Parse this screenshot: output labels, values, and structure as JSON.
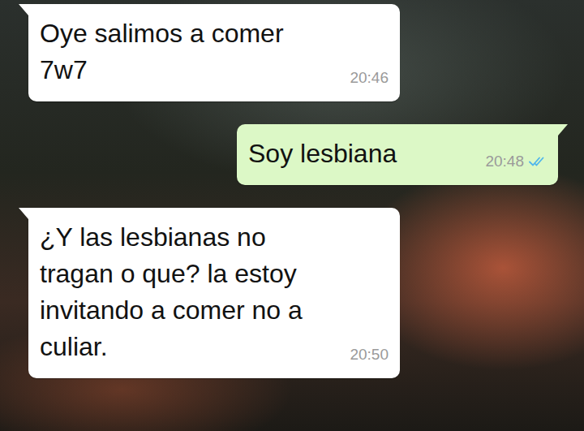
{
  "messages": [
    {
      "lines": [
        "Oye salimos a comer",
        "7w7"
      ],
      "time": "20:46",
      "outgoing": false
    },
    {
      "lines": [
        "Soy lesbiana"
      ],
      "time": "20:48",
      "outgoing": true,
      "read": true
    },
    {
      "lines": [
        "¿Y las lesbianas no",
        "tragan o que? la estoy",
        "invitando a comer no a",
        "culiar."
      ],
      "time": "20:50",
      "outgoing": false
    }
  ]
}
